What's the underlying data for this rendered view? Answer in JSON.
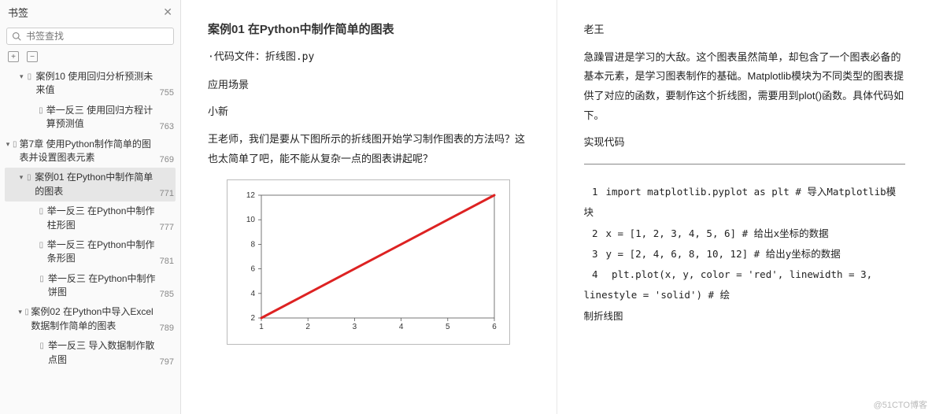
{
  "sidebar": {
    "title": "书签",
    "search_placeholder": "书签查找",
    "tool_expand": "+",
    "tool_collapse": "−",
    "tree": [
      {
        "level": 1,
        "arrow": "▾",
        "label": "案例10   使用回归分析预测未来值",
        "page": "755",
        "active": false
      },
      {
        "level": 2,
        "arrow": "",
        "label": "举一反三   使用回归方程计算预测值",
        "page": "763",
        "active": false
      },
      {
        "level": 0,
        "arrow": "▾",
        "label": "第7章   使用Python制作简单的图表并设置图表元素",
        "page": "769",
        "active": false
      },
      {
        "level": 1,
        "arrow": "▾",
        "label": "案例01   在Python中制作简单的图表",
        "page": "771",
        "active": true
      },
      {
        "level": 2,
        "arrow": "",
        "label": "举一反三   在Python中制作柱形图",
        "page": "777",
        "active": false
      },
      {
        "level": 2,
        "arrow": "",
        "label": "举一反三   在Python中制作条形图",
        "page": "781",
        "active": false
      },
      {
        "level": 2,
        "arrow": "",
        "label": "举一反三   在Python中制作饼图",
        "page": "785",
        "active": false
      },
      {
        "level": 1,
        "arrow": "▾",
        "label": "案例02   在Python中导入Excel数据制作简单的图表",
        "page": "789",
        "active": false
      },
      {
        "level": 2,
        "arrow": "",
        "label": "举一反三   导入数据制作散点图",
        "page": "797",
        "active": false
      }
    ]
  },
  "left_page": {
    "title": "案例01    在Python中制作简单的图表",
    "file_line": "·代码文件：折线图.py",
    "scene_label": "应用场景",
    "speaker1": "小新",
    "body1": "王老师，我们是要从下图所示的折线图开始学习制作图表的方法吗？这也太简单了吧，能不能从复杂一点的图表讲起呢？"
  },
  "right_page": {
    "speaker2": "老王",
    "body2": "急躁冒进是学习的大敌。这个图表虽然简单，却包含了一个图表必备的基本元素，是学习图表制作的基础。Matplotlib模块为不同类型的图表提供了对应的函数，要制作这个折线图，需要用到plot()函数。具体代码如下。",
    "impl_label": "实现代码",
    "code_lines": [
      {
        "n": "1",
        "t": "import  matplotlib.pyplot  as  plt     #  导入Matplotlib模块"
      },
      {
        "n": "2",
        "t": "x  =  [1,  2,  3,  4,  5,  6]     #  给出x坐标的数据"
      },
      {
        "n": "3",
        "t": "y  =  [2,  4,  6,  8,  10,  12]     #  给出y坐标的数据"
      },
      {
        "n": "4",
        "t": "  plt.plot(x,  y,  color = 'red',  linewidth = 3,  linestyle  = 'solid')     #  绘"
      }
    ],
    "code_tail": "制折线图"
  },
  "chart_data": {
    "type": "line",
    "x": [
      1,
      2,
      3,
      4,
      5,
      6
    ],
    "values": [
      2,
      4,
      6,
      8,
      10,
      12
    ],
    "xlim": [
      1,
      6
    ],
    "ylim": [
      2,
      12
    ],
    "xticks": [
      1,
      2,
      3,
      4,
      5,
      6
    ],
    "yticks": [
      2,
      4,
      6,
      8,
      10,
      12
    ],
    "line_color": "#d22",
    "linewidth": 3,
    "linestyle": "solid"
  },
  "watermark": "@51CTO博客"
}
